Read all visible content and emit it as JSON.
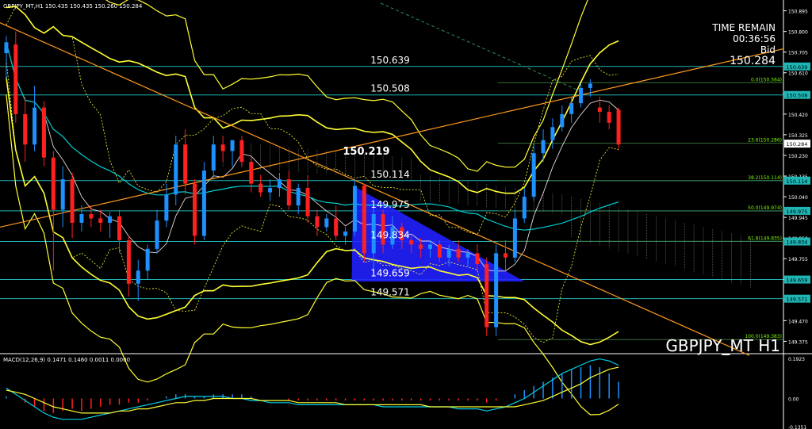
{
  "header": {
    "symbol_line": "GBPJPY_MT,H1  150.435 150.435 150.260 150.284",
    "macd_line": "MACD(12,26,9) 0.1471 0.1460 0.0011 0.0000"
  },
  "overlay": {
    "time_remain_label": "TIME REMAIN",
    "time_remain_value": "00:36:56",
    "bid_label": "Bid",
    "bid_value": "150.284",
    "watermark": "GBPJPY_MT H1"
  },
  "colors": {
    "background": "#000000",
    "bull": "#1E90FF",
    "bear": "#FF2020",
    "level_line": "#1FB5B5",
    "bollinger": "#FFFF33",
    "trendline": "#FF9A1E",
    "triangle": "#2020FF",
    "fib_text": "#7CFC00",
    "macd_line": "#00CFE8",
    "macd_signal": "#FFFF33"
  },
  "chart_data": [
    {
      "type": "candlestick",
      "title": "GBPJPY_MT,H1",
      "y_axis_ticks": [
        "150.895",
        "150.800",
        "150.705",
        "150.610",
        "150.515",
        "150.420",
        "150.325",
        "150.230",
        "150.135",
        "150.040",
        "149.945",
        "149.850",
        "149.755",
        "149.660",
        "149.565",
        "149.470",
        "149.375"
      ],
      "ylim": [
        149.34,
        150.93
      ],
      "level_labels": [
        "150.639",
        "150.508",
        "150.219",
        "150.114",
        "149.975",
        "149.834",
        "149.659",
        "149.571"
      ],
      "price_markers": [
        "150.639",
        "150.508",
        "150.284",
        "150.114",
        "149.975",
        "149.834",
        "149.659",
        "149.571"
      ],
      "fibonacci": [
        {
          "label": "0.0(150.564)",
          "value": 150.564
        },
        {
          "label": "23.6(150.286)",
          "value": 150.286
        },
        {
          "label": "38.2(150.114)",
          "value": 150.114
        },
        {
          "label": "50.0(149.974)",
          "value": 149.974
        },
        {
          "label": "61.8(149.835)",
          "value": 149.835
        },
        {
          "label": "100.0(149.383)",
          "value": 149.383
        }
      ],
      "candles": [
        {
          "o": 150.7,
          "h": 150.78,
          "l": 150.58,
          "c": 150.75
        },
        {
          "o": 150.74,
          "h": 150.8,
          "l": 150.38,
          "c": 150.42
        },
        {
          "o": 150.42,
          "h": 150.5,
          "l": 150.2,
          "c": 150.28
        },
        {
          "o": 150.28,
          "h": 150.55,
          "l": 150.25,
          "c": 150.45
        },
        {
          "o": 150.45,
          "h": 150.48,
          "l": 150.18,
          "c": 150.22
        },
        {
          "o": 150.22,
          "h": 150.25,
          "l": 149.7,
          "c": 149.98
        },
        {
          "o": 149.98,
          "h": 150.18,
          "l": 149.9,
          "c": 150.12
        },
        {
          "o": 150.12,
          "h": 150.15,
          "l": 149.85,
          "c": 149.92
        },
        {
          "o": 149.92,
          "h": 150.0,
          "l": 149.88,
          "c": 149.96
        },
        {
          "o": 149.96,
          "h": 150.0,
          "l": 149.9,
          "c": 149.94
        },
        {
          "o": 149.94,
          "h": 149.98,
          "l": 149.88,
          "c": 149.92
        },
        {
          "o": 149.92,
          "h": 149.97,
          "l": 149.85,
          "c": 149.95
        },
        {
          "o": 149.95,
          "h": 149.98,
          "l": 149.78,
          "c": 149.84
        },
        {
          "o": 149.84,
          "h": 149.86,
          "l": 149.58,
          "c": 149.64
        },
        {
          "o": 149.64,
          "h": 149.75,
          "l": 149.56,
          "c": 149.7
        },
        {
          "o": 149.7,
          "h": 149.82,
          "l": 149.66,
          "c": 149.8
        },
        {
          "o": 149.8,
          "h": 149.98,
          "l": 149.78,
          "c": 149.93
        },
        {
          "o": 149.93,
          "h": 150.1,
          "l": 149.9,
          "c": 150.05
        },
        {
          "o": 150.05,
          "h": 150.32,
          "l": 150.0,
          "c": 150.28
        },
        {
          "o": 150.28,
          "h": 150.35,
          "l": 150.05,
          "c": 150.1
        },
        {
          "o": 150.1,
          "h": 150.12,
          "l": 149.82,
          "c": 149.86
        },
        {
          "o": 149.86,
          "h": 150.2,
          "l": 149.84,
          "c": 150.16
        },
        {
          "o": 150.16,
          "h": 150.32,
          "l": 150.12,
          "c": 150.28
        },
        {
          "o": 150.28,
          "h": 150.32,
          "l": 150.2,
          "c": 150.25
        },
        {
          "o": 150.25,
          "h": 150.3,
          "l": 150.18,
          "c": 150.3
        },
        {
          "o": 150.3,
          "h": 150.32,
          "l": 150.18,
          "c": 150.2
        },
        {
          "o": 150.2,
          "h": 150.22,
          "l": 150.06,
          "c": 150.1
        },
        {
          "o": 150.1,
          "h": 150.14,
          "l": 150.04,
          "c": 150.06
        },
        {
          "o": 150.06,
          "h": 150.12,
          "l": 150.02,
          "c": 150.08
        },
        {
          "o": 150.08,
          "h": 150.15,
          "l": 150.04,
          "c": 150.12
        },
        {
          "o": 150.12,
          "h": 150.16,
          "l": 149.98,
          "c": 150.0
        },
        {
          "o": 150.0,
          "h": 150.1,
          "l": 149.96,
          "c": 150.08
        },
        {
          "o": 150.08,
          "h": 150.14,
          "l": 149.92,
          "c": 149.95
        },
        {
          "o": 149.95,
          "h": 149.98,
          "l": 149.86,
          "c": 149.9
        },
        {
          "o": 149.9,
          "h": 149.96,
          "l": 149.88,
          "c": 149.94
        },
        {
          "o": 149.94,
          "h": 150.0,
          "l": 149.84,
          "c": 149.86
        },
        {
          "o": 149.86,
          "h": 149.9,
          "l": 149.82,
          "c": 149.88
        },
        {
          "o": 149.88,
          "h": 150.12,
          "l": 149.86,
          "c": 150.09
        },
        {
          "o": 150.09,
          "h": 150.1,
          "l": 149.74,
          "c": 149.78
        },
        {
          "o": 149.78,
          "h": 150.0,
          "l": 149.7,
          "c": 149.96
        },
        {
          "o": 149.96,
          "h": 149.98,
          "l": 149.78,
          "c": 149.82
        },
        {
          "o": 149.82,
          "h": 149.95,
          "l": 149.8,
          "c": 149.9
        },
        {
          "o": 149.9,
          "h": 149.92,
          "l": 149.8,
          "c": 149.84
        },
        {
          "o": 149.84,
          "h": 149.86,
          "l": 149.78,
          "c": 149.82
        },
        {
          "o": 149.82,
          "h": 149.85,
          "l": 149.76,
          "c": 149.8
        },
        {
          "o": 149.8,
          "h": 149.84,
          "l": 149.76,
          "c": 149.82
        },
        {
          "o": 149.82,
          "h": 149.84,
          "l": 149.74,
          "c": 149.76
        },
        {
          "o": 149.76,
          "h": 149.82,
          "l": 149.72,
          "c": 149.8
        },
        {
          "o": 149.8,
          "h": 149.84,
          "l": 149.74,
          "c": 149.76
        },
        {
          "o": 149.76,
          "h": 149.8,
          "l": 149.72,
          "c": 149.78
        },
        {
          "o": 149.78,
          "h": 149.82,
          "l": 149.7,
          "c": 149.73
        },
        {
          "o": 149.73,
          "h": 149.76,
          "l": 149.4,
          "c": 149.44
        },
        {
          "o": 149.44,
          "h": 149.82,
          "l": 149.4,
          "c": 149.78
        },
        {
          "o": 149.78,
          "h": 149.84,
          "l": 149.7,
          "c": 149.76
        },
        {
          "o": 149.76,
          "h": 149.98,
          "l": 149.74,
          "c": 149.94
        },
        {
          "o": 149.94,
          "h": 150.08,
          "l": 149.92,
          "c": 150.04
        },
        {
          "o": 150.04,
          "h": 150.28,
          "l": 150.02,
          "c": 150.24
        },
        {
          "o": 150.24,
          "h": 150.35,
          "l": 150.2,
          "c": 150.3
        },
        {
          "o": 150.3,
          "h": 150.4,
          "l": 150.26,
          "c": 150.36
        },
        {
          "o": 150.36,
          "h": 150.46,
          "l": 150.34,
          "c": 150.42
        },
        {
          "o": 150.42,
          "h": 150.5,
          "l": 150.38,
          "c": 150.47
        },
        {
          "o": 150.47,
          "h": 150.56,
          "l": 150.45,
          "c": 150.54
        },
        {
          "o": 150.54,
          "h": 150.58,
          "l": 150.5,
          "c": 150.56
        },
        {
          "o": 150.45,
          "h": 150.5,
          "l": 150.38,
          "c": 150.43
        },
        {
          "o": 150.43,
          "h": 150.46,
          "l": 150.35,
          "c": 150.38
        },
        {
          "o": 150.44,
          "h": 150.45,
          "l": 150.26,
          "c": 150.28
        }
      ]
    },
    {
      "type": "histogram",
      "title": "MACD(12,26,9) 0.1471 0.1460 0.0011 0.0000",
      "y_axis_ticks": [
        "0.1923",
        "0.00",
        "-0.1351"
      ],
      "ylim": [
        -0.1351,
        0.1923
      ],
      "histogram": [
        0.01,
        0.0,
        -0.02,
        -0.04,
        -0.06,
        -0.07,
        -0.06,
        -0.05,
        -0.06,
        -0.05,
        -0.04,
        -0.03,
        -0.03,
        -0.02,
        -0.02,
        -0.01,
        0.0,
        0.01,
        0.02,
        0.02,
        0.01,
        0.01,
        0.02,
        0.02,
        0.02,
        0.02,
        0.01,
        0.0,
        0.0,
        0.0,
        -0.01,
        -0.01,
        -0.01,
        -0.01,
        -0.01,
        -0.01,
        -0.01,
        -0.01,
        -0.01,
        -0.01,
        -0.01,
        -0.01,
        -0.01,
        -0.01,
        -0.01,
        -0.01,
        -0.01,
        -0.01,
        -0.01,
        -0.01,
        -0.01,
        -0.02,
        -0.01,
        0.0,
        0.02,
        0.04,
        0.06,
        0.08,
        0.1,
        0.12,
        0.14,
        0.15,
        0.16,
        0.15,
        0.12,
        0.08
      ],
      "macd_line": [
        0.05,
        0.02,
        -0.01,
        -0.04,
        -0.07,
        -0.09,
        -0.1,
        -0.1,
        -0.1,
        -0.09,
        -0.08,
        -0.07,
        -0.06,
        -0.05,
        -0.04,
        -0.03,
        -0.02,
        -0.01,
        0.0,
        0.01,
        0.01,
        0.01,
        0.01,
        0.01,
        0.0,
        0.0,
        -0.01,
        -0.01,
        -0.02,
        -0.02,
        -0.02,
        -0.03,
        -0.03,
        -0.03,
        -0.03,
        -0.03,
        -0.03,
        -0.03,
        -0.03,
        -0.03,
        -0.04,
        -0.04,
        -0.04,
        -0.04,
        -0.04,
        -0.04,
        -0.04,
        -0.04,
        -0.05,
        -0.05,
        -0.05,
        -0.06,
        -0.05,
        -0.04,
        -0.02,
        0.0,
        0.03,
        0.06,
        0.09,
        0.12,
        0.14,
        0.16,
        0.18,
        0.19,
        0.18,
        0.16
      ],
      "signal_line": [
        0.04,
        0.03,
        0.02,
        0.0,
        -0.02,
        -0.04,
        -0.05,
        -0.06,
        -0.07,
        -0.07,
        -0.07,
        -0.07,
        -0.06,
        -0.06,
        -0.05,
        -0.05,
        -0.04,
        -0.03,
        -0.02,
        -0.02,
        -0.01,
        -0.01,
        0.0,
        0.0,
        0.0,
        0.0,
        0.0,
        -0.01,
        -0.01,
        -0.01,
        -0.01,
        -0.02,
        -0.02,
        -0.02,
        -0.02,
        -0.02,
        -0.03,
        -0.03,
        -0.03,
        -0.03,
        -0.03,
        -0.03,
        -0.03,
        -0.03,
        -0.03,
        -0.04,
        -0.04,
        -0.04,
        -0.04,
        -0.04,
        -0.04,
        -0.04,
        -0.04,
        -0.04,
        -0.04,
        -0.03,
        -0.02,
        -0.01,
        0.01,
        0.03,
        0.05,
        0.07,
        0.1,
        0.12,
        0.14,
        0.15
      ]
    }
  ]
}
